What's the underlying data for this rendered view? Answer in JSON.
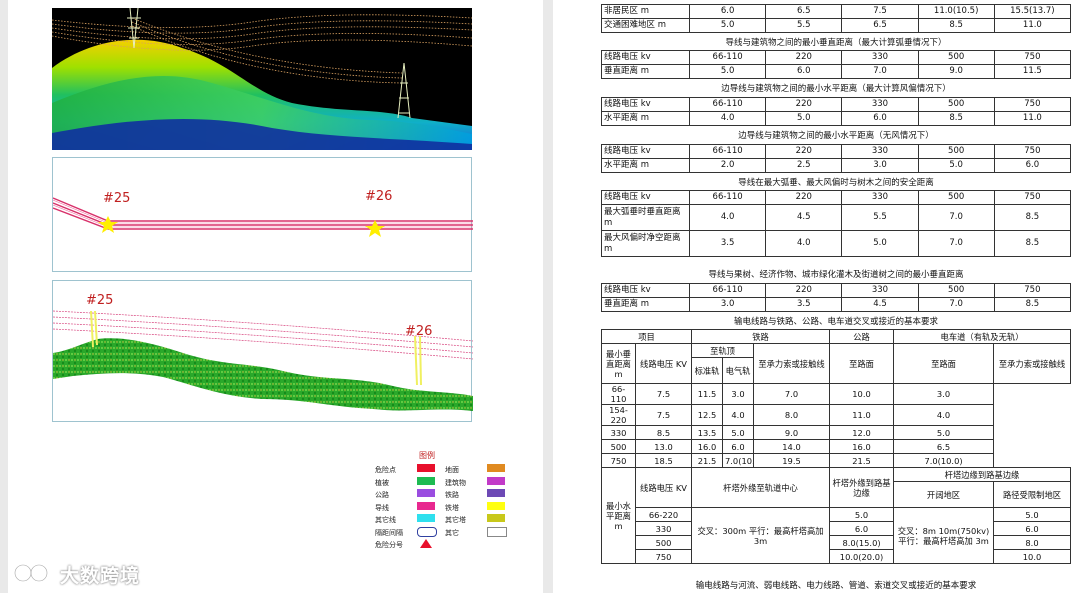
{
  "figure": {
    "labels_top": [
      "#25",
      "#26"
    ],
    "labels_pc": [
      "#25",
      "#26"
    ],
    "legend": {
      "title": "图例",
      "items": [
        {
          "label": "危险点",
          "color": "#e8102c"
        },
        {
          "label": "地面",
          "color": "#e08a20"
        },
        {
          "label": "植被",
          "color": "#1dbb52"
        },
        {
          "label": "建筑物",
          "color": "#c23ac8"
        },
        {
          "label": "公路",
          "color": "#9a4de0"
        },
        {
          "label": "铁路",
          "color": "#6d49b5"
        },
        {
          "label": "导线",
          "color": "#e8288f"
        },
        {
          "label": "铁塔",
          "color": "#ffff10"
        },
        {
          "label": "其它线",
          "color": "#2fe0ee"
        },
        {
          "label": "其它塔",
          "color": "#c8c81a"
        },
        {
          "label": "隔距间隔",
          "color": "#ffffff"
        },
        {
          "label": "其它",
          "color": "#ffffff"
        },
        {
          "label": "危险分号",
          "color": "#e8102c"
        }
      ]
    }
  },
  "watermark": {
    "text": "大数跨境"
  },
  "tables": {
    "t0": [
      [
        "非居民区 m",
        "6.0",
        "6.5",
        "7.5",
        "11.0(10.5)",
        "15.5(13.7)"
      ],
      [
        "交通困难地区 m",
        "5.0",
        "5.5",
        "6.5",
        "8.5",
        "11.0"
      ]
    ],
    "cap1": "导线与建筑物之间的最小垂直距离（最大计算弧垂情况下）",
    "t1": [
      [
        "线路电压 kv",
        "66-110",
        "220",
        "330",
        "500",
        "750"
      ],
      [
        "垂直距离 m",
        "5.0",
        "6.0",
        "7.0",
        "9.0",
        "11.5"
      ]
    ],
    "cap2": "边导线与建筑物之间的最小水平距离（最大计算风偏情况下）",
    "t2": [
      [
        "线路电压 kv",
        "66-110",
        "220",
        "330",
        "500",
        "750"
      ],
      [
        "水平距离 m",
        "4.0",
        "5.0",
        "6.0",
        "8.5",
        "11.0"
      ]
    ],
    "cap3": "边导线与建筑物之间的最小水平距离（无风情况下）",
    "t3": [
      [
        "线路电压 kv",
        "66-110",
        "220",
        "330",
        "500",
        "750"
      ],
      [
        "水平距离 m",
        "2.0",
        "2.5",
        "3.0",
        "5.0",
        "6.0"
      ]
    ],
    "cap4": "导线在最大弧垂、最大风偏时与树木之间的安全距离",
    "t4": [
      [
        "线路电压 kv",
        "66-110",
        "220",
        "330",
        "500",
        "750"
      ],
      [
        "最大弧垂时垂直距离 m",
        "4.0",
        "4.5",
        "5.5",
        "7.0",
        "8.5"
      ],
      [
        "最大风偏时净空距离 m",
        "3.5",
        "4.0",
        "5.0",
        "7.0",
        "8.5"
      ]
    ],
    "cap5": "导线与果树、经济作物、城市绿化灌木及街道树之间的最小垂直距离",
    "t5": [
      [
        "线路电压 kv",
        "66-110",
        "220",
        "330",
        "500",
        "750"
      ],
      [
        "垂直距离 m",
        "3.0",
        "3.5",
        "4.5",
        "7.0",
        "8.5"
      ]
    ],
    "cap6": "输电线路与铁路、公路、电车道交叉或接近的基本要求",
    "big": {
      "h_item": "项目",
      "h_rail": "铁路",
      "h_road": "公路",
      "h_tram": "电车道（有轨及无轨）",
      "h_vmin": "最小垂直距离 m",
      "h_volt": "线路电压 KV",
      "h_railtop": "至轨顶",
      "h_std": "标准轨",
      "h_elec": "电气轨",
      "h_catenary": "至承力索或接触线",
      "h_roadsurf": "至路面",
      "h_tramsurf": "至路面",
      "h_tramcat": "至承力索或接触线",
      "rows": [
        [
          "66-110",
          "7.5",
          "11.5",
          "3.0",
          "7.0",
          "10.0",
          "3.0"
        ],
        [
          "154-220",
          "7.5",
          "12.5",
          "4.0",
          "8.0",
          "11.0",
          "4.0"
        ],
        [
          "330",
          "8.5",
          "13.5",
          "5.0",
          "9.0",
          "12.0",
          "5.0"
        ],
        [
          "500",
          "13.0",
          "16.0",
          "6.0",
          "14.0",
          "16.0",
          "6.5"
        ],
        [
          "750",
          "18.5",
          "21.5",
          "7.0(10.0)",
          "19.5",
          "21.5",
          "7.0(10.0)"
        ]
      ],
      "h_hmin": "最小水平距离 m",
      "h_volt2": "线路电压 KV",
      "h_tower_rail": "杆塔外缘至轨道中心",
      "h_tower_road": "杆塔外缘到路基边缘",
      "h_tower_road2": "杆塔边缘到路基边缘",
      "h_tower_tram": "杆塔边缘到路基边缘",
      "h_open": "开阔地区",
      "h_restricted": "路径受限制地区",
      "volts2": [
        "66-220",
        "330",
        "500",
        "750"
      ],
      "rail_note": "交叉：300m 平行：最高杆塔高加 3m",
      "road_note": "交叉：8m 10m(750kv) 平行：最高杆塔高加 3m",
      "road_vals": [
        "5.0",
        "6.0",
        "8.0(15.0)",
        "10.0(20.0)"
      ],
      "tram_note": "交叉：8m 10m(750kv) 平行：最高杆塔高加 3m",
      "tram_vals": [
        "5.0",
        "6.0",
        "8.0",
        "10.0"
      ]
    },
    "cap7": "输电线路与河流、弱电线路、电力线路、管道、索道交叉或接近的基本要求"
  }
}
